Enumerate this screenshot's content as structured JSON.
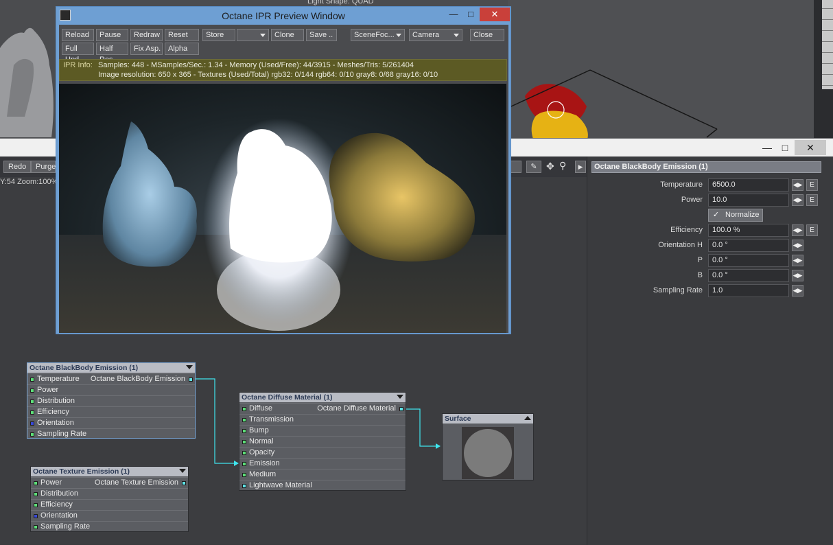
{
  "background": {
    "light_shape_text": "Light Shape: QUAD"
  },
  "ipr_window": {
    "title": "Octane IPR Preview Window",
    "toolbar_row1": {
      "reload": "Reload",
      "pause": "Pause",
      "redraw": "Redraw",
      "reset": "Reset",
      "store": "Store",
      "clone": "Clone",
      "save": "Save ..",
      "scene_focus": "SceneFoc...",
      "camera": "Camera",
      "close": "Close"
    },
    "toolbar_row2": {
      "full_upd": "Full Upd.",
      "half_res": "Half Res",
      "fix_asp": "Fix Asp.",
      "alpha": "Alpha"
    },
    "info": {
      "label": "IPR Info:",
      "line1": "Samples: 448  -  MSamples/Sec.: 1.34  -  Memory (Used/Free): 44/3915  -  Meshes/Tris: 5/261404",
      "line2": "Image resolution: 650 x 365 - Textures (Used/Total) rgb32: 0/144   rgb64: 0/10   gray8: 0/68   gray16: 0/10"
    }
  },
  "node_editor": {
    "toolbar": {
      "redo": "Redo",
      "purge": "Purge"
    },
    "status": "Y:54 Zoom:100%",
    "nodes": {
      "blackbody": {
        "title": "Octane BlackBody Emission (1)",
        "output": "Octane BlackBody Emission",
        "inputs": [
          "Temperature",
          "Power",
          "Distribution",
          "Efficiency",
          "Orientation",
          "Sampling Rate"
        ]
      },
      "texture_emission": {
        "title": "Octane Texture Emission (1)",
        "output": "Octane Texture Emission",
        "inputs": [
          "Power",
          "Distribution",
          "Efficiency",
          "Orientation",
          "Sampling Rate"
        ]
      },
      "diffuse": {
        "title": "Octane Diffuse Material (1)",
        "output": "Octane Diffuse Material",
        "inputs": [
          "Diffuse",
          "Transmission",
          "Bump",
          "Normal",
          "Opacity",
          "Emission",
          "Medium",
          "Lightwave Material"
        ]
      },
      "surface": {
        "title": "Surface"
      }
    }
  },
  "properties": {
    "title": "Octane BlackBody Emission (1)",
    "temperature": {
      "label": "Temperature",
      "value": "6500.0"
    },
    "power": {
      "label": "Power",
      "value": "10.0"
    },
    "normalize": {
      "label": "Normalize",
      "checked": true
    },
    "efficiency": {
      "label": "Efficiency",
      "value": "100.0 %"
    },
    "orientation_h": {
      "label": "Orientation H",
      "value": "0.0 °"
    },
    "p": {
      "label": "P",
      "value": "0.0 °"
    },
    "b": {
      "label": "B",
      "value": "0.0 °"
    },
    "sampling_rate": {
      "label": "Sampling Rate",
      "value": "1.0"
    },
    "e_label": "E"
  },
  "colors": {
    "accent_selection": "#7aa6d6",
    "connection": "#3fe6ee",
    "ipr_frame": "#6e9fd3",
    "info_bar": "#5c5a24"
  }
}
